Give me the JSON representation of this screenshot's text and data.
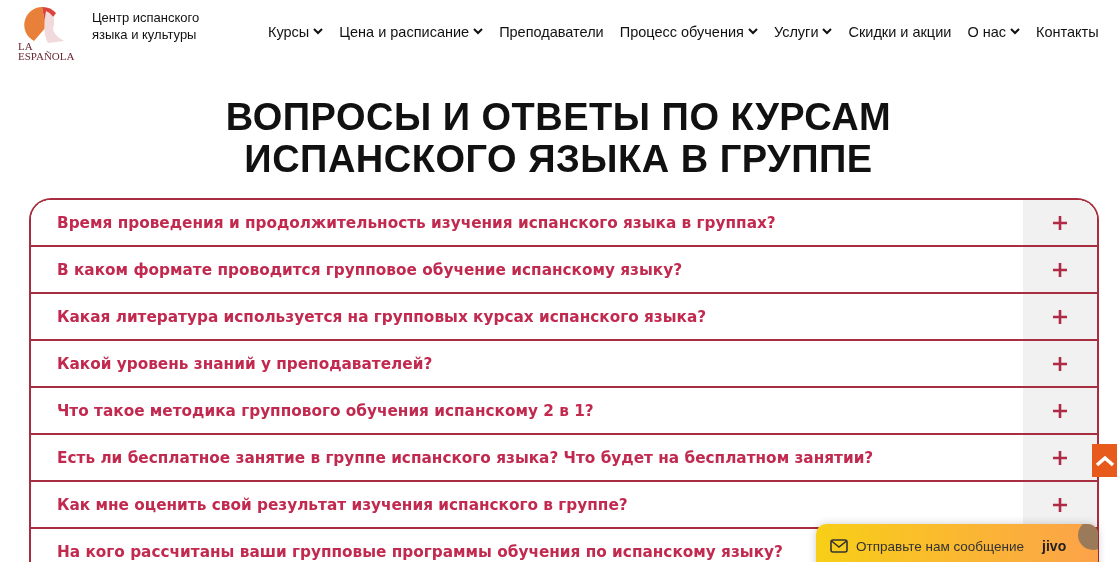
{
  "logo": {
    "line_1": "LA",
    "line_2": "ESPAÑOLA"
  },
  "site_name": "Центр испанского языка и культуры",
  "nav": [
    {
      "label": "Курсы",
      "has_dropdown": true
    },
    {
      "label": "Цена и расписание",
      "has_dropdown": true
    },
    {
      "label": "Преподаватели",
      "has_dropdown": false
    },
    {
      "label": "Процесс обучения",
      "has_dropdown": true
    },
    {
      "label": "Услуги",
      "has_dropdown": true
    },
    {
      "label": "Скидки и акции",
      "has_dropdown": false
    },
    {
      "label": "О нас",
      "has_dropdown": true
    },
    {
      "label": "Контакты",
      "has_dropdown": false
    }
  ],
  "heading": "ВОПРОСЫ И ОТВЕТЫ ПО КУРСАМ ИСПАНСКОГО ЯЗЫКА В ГРУППЕ",
  "faq": [
    {
      "question": "Время проведения и продолжительность изучения испанского языка в группах?",
      "expanded": false
    },
    {
      "question": "В каком формате проводится групповое обучение испанскому языку?",
      "expanded": false
    },
    {
      "question": "Какая литература используется на групповых курсах испанского языка?",
      "expanded": false
    },
    {
      "question": "Какой уровень знаний у преподавателей?",
      "expanded": false
    },
    {
      "question": "Что такое методика группового обучения испанскому 2 в 1?",
      "expanded": false
    },
    {
      "question": "Есть ли бесплатное занятие в группе испанского языка? Что будет на бесплатном занятии?",
      "expanded": false
    },
    {
      "question": "Как мне оценить свой результат изучения испанского в группе?",
      "expanded": false
    },
    {
      "question": "На кого рассчитаны ваши групповые программы обучения по испанскому языку?"
    }
  ],
  "chat_widget": {
    "label": "Отправьте нам сообщение",
    "brand": "jivo"
  }
}
